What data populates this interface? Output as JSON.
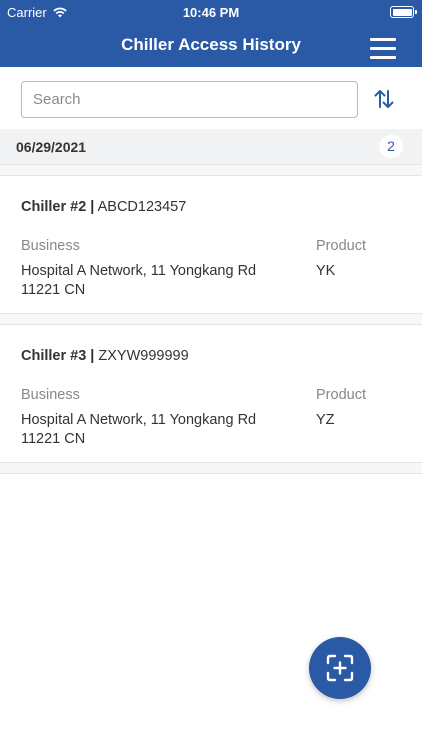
{
  "status_bar": {
    "carrier": "Carrier",
    "time": "10:46 PM"
  },
  "header": {
    "title": "Chiller Access History",
    "menu_icon": "hamburger-menu-icon"
  },
  "search": {
    "placeholder": "Search",
    "value": "",
    "sort_icon": "sort-arrows-icon"
  },
  "group": {
    "date": "06/29/2021",
    "count": "2"
  },
  "labels": {
    "business": "Business",
    "product": "Product"
  },
  "records": [
    {
      "chiller": "Chiller #2 |",
      "serial": "ABCD123457",
      "business_line1": "Hospital A Network, 11 Yongkang Rd",
      "business_line2": "11221 CN",
      "product": "YK"
    },
    {
      "chiller": "Chiller #3 |",
      "serial": "ZXYW999999",
      "business_line1": "Hospital A Network, 11 Yongkang Rd",
      "business_line2": "11221 CN",
      "product": "YZ"
    }
  ],
  "fab": {
    "icon": "scan-add-icon"
  },
  "colors": {
    "primary": "#2a59a6",
    "section_bg": "#f1f2f4"
  }
}
